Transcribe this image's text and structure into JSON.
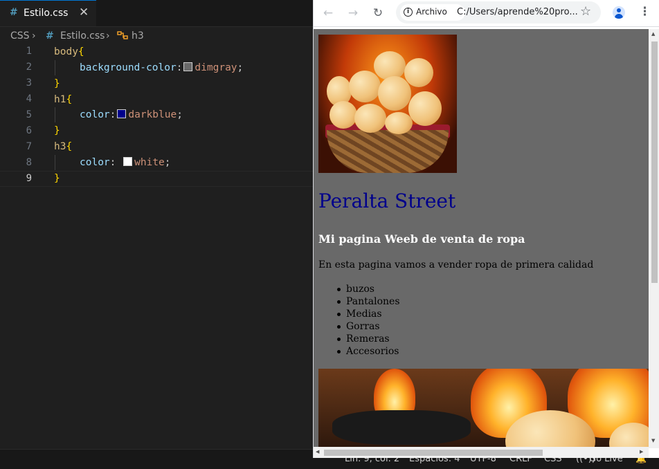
{
  "editor": {
    "tab": {
      "icon": "#",
      "label": "Estilo.css",
      "close": "✕"
    },
    "breadcrumb": {
      "lang": "CSS",
      "file_icon": "#",
      "file": "Estilo.css",
      "symbol": "h3",
      "sep": "›"
    },
    "line_numbers": [
      "1",
      "2",
      "3",
      "4",
      "5",
      "6",
      "7",
      "8",
      "9"
    ],
    "code": {
      "l1_selector": "body",
      "l1_brace": "{",
      "l2_prop": "background-color",
      "l2_colon": ":",
      "l2_value": "dimgray",
      "l2_semi": ";",
      "l3_brace": "}",
      "l4_selector": "h1",
      "l4_brace": "{",
      "l5_prop": "color",
      "l5_colon": ":",
      "l5_value": "darkblue",
      "l5_semi": ";",
      "l6_brace": "}",
      "l7_selector": "h3",
      "l7_brace": "{",
      "l8_prop": "color",
      "l8_colon": ": ",
      "l8_value": "white",
      "l8_semi": ";",
      "l9_brace": "}"
    },
    "swatch_colors": {
      "dimgray": "#696969",
      "darkblue": "#00008b",
      "white": "#ffffff"
    }
  },
  "statusbar": {
    "position": "Lín. 9, col. 2",
    "spaces": "Espacios: 4",
    "encoding": "UTF-8",
    "eol": "CRLF",
    "language": "CSS",
    "golive": "Go Live"
  },
  "browser": {
    "chip_label": "Archivo",
    "url": "C:/Users/aprende%20pro...",
    "page": {
      "h1": "Peralta Street",
      "h3": "Mi pagina Weeb de venta de ropa",
      "paragraph": "En esta pagina vamos a vender ropa de primera calidad",
      "list": [
        "buzos",
        "Pantalones",
        "Medias",
        "Gorras",
        "Remeras",
        "Accesorios"
      ]
    }
  }
}
